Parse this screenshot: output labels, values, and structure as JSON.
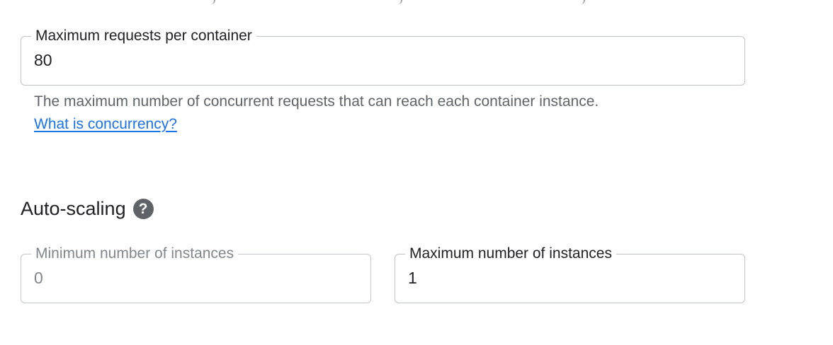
{
  "concurrency": {
    "label": "Maximum requests per container",
    "value": "80",
    "helper_text": "The maximum number of concurrent requests that can reach each container instance.",
    "link_text": "What is concurrency?"
  },
  "autoscaling": {
    "title": "Auto-scaling",
    "help_icon": "help-icon",
    "min_instances": {
      "label": "Minimum number of instances",
      "value": "0"
    },
    "max_instances": {
      "label": "Maximum number of instances",
      "value": "1"
    }
  },
  "colors": {
    "link": "#1a73e8",
    "border": "#c5c8cc",
    "muted_text": "#80868b"
  }
}
